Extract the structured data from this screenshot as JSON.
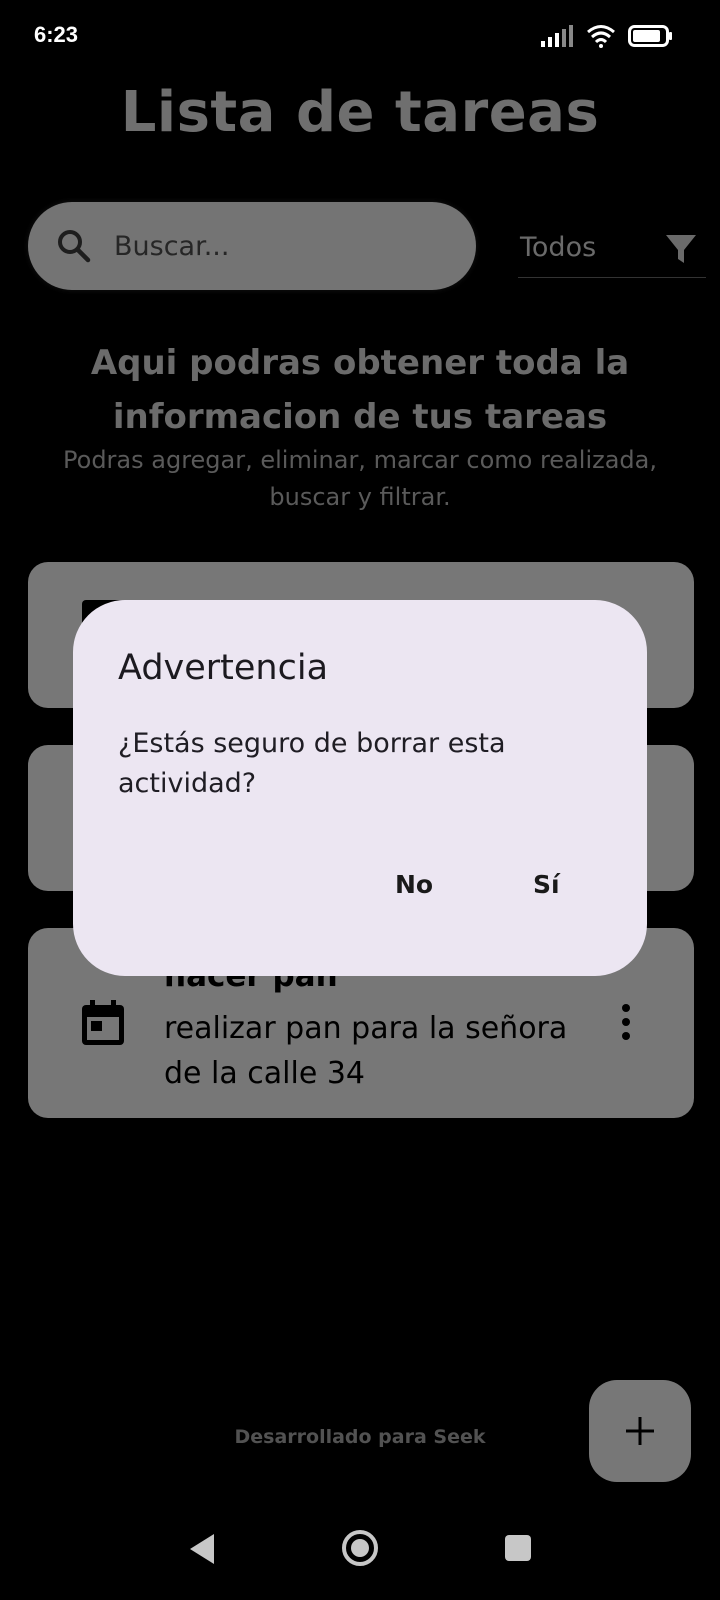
{
  "status_bar": {
    "time": "6:23",
    "battery": "83"
  },
  "app": {
    "title": "Lista de tareas"
  },
  "search": {
    "placeholder": "Buscar..."
  },
  "filter": {
    "selected": "Todos"
  },
  "intro": {
    "title": "Aqui podras obtener toda la informacion de tus tareas",
    "subtitle": "Podras agregar, eliminar, marcar como realizada, buscar y filtrar."
  },
  "tasks": [
    {
      "title": "",
      "description": ""
    },
    {
      "title": "",
      "description": ""
    },
    {
      "title": "hacer pan",
      "description": "realizar pan para la señora de la calle 34"
    }
  ],
  "dialog": {
    "title": "Advertencia",
    "message": "¿Estás seguro de borrar esta actividad?",
    "no_label": "No",
    "yes_label": "Sí"
  },
  "footer": {
    "text": "Desarrollado para Seek"
  },
  "colors": {
    "background": "#000000",
    "card": "#777777",
    "dialog": "#ece6f2"
  }
}
